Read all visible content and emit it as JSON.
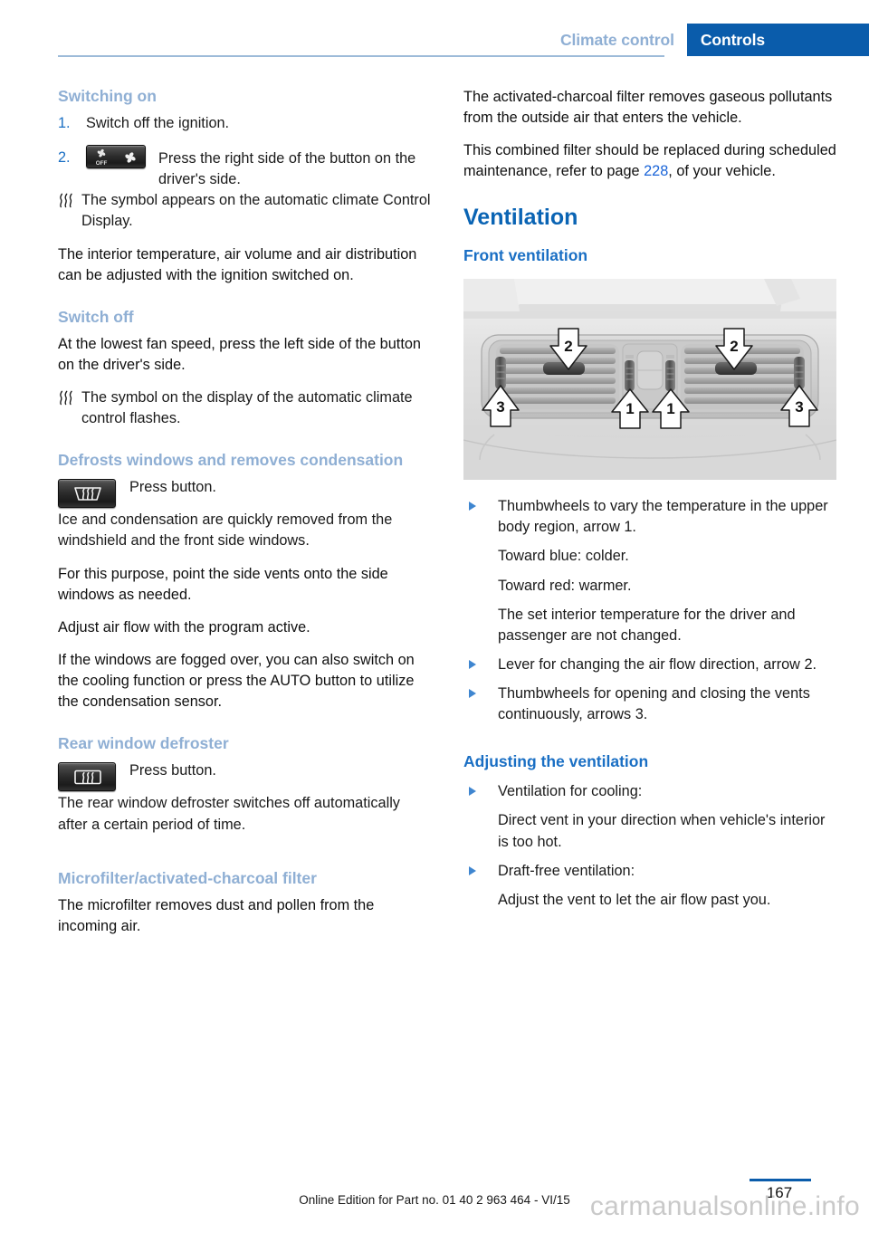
{
  "header": {
    "chapter": "Climate control",
    "section": "Controls"
  },
  "left_column": {
    "switching_on": {
      "heading": "Switching on",
      "step1_num": "1.",
      "step1_text": "Switch off the ignition.",
      "step2_num": "2.",
      "step2_icon_off_label": "OFF",
      "step2_text": "Press the right side of the button on the driver's side.",
      "note": "The symbol appears on the automatic climate Control Display.",
      "para": "The interior temperature, air volume and air distribution can be adjusted with the ignition switched on."
    },
    "switch_off": {
      "heading": "Switch off",
      "para": "At the lowest fan speed, press the left side of the button on the driver's side.",
      "note": "The symbol on the display of the automatic climate control flashes."
    },
    "defrost": {
      "heading": "Defrosts windows and removes condensation",
      "press_button": "Press button.",
      "para1": "Ice and condensation are quickly removed from the windshield and the front side windows.",
      "para2": "For this purpose, point the side vents onto the side windows as needed.",
      "para3": "Adjust air flow with the program active.",
      "para4": "If the windows are fogged over, you can also switch on the cooling function or press the AUTO button to utilize the condensation sensor."
    },
    "rear_defroster": {
      "heading": "Rear window defroster",
      "press_button": "Press button.",
      "para": "The rear window defroster switches off automatically after a certain period of time."
    },
    "microfilter": {
      "heading": "Microfilter/activated-charcoal filter",
      "para": "The microfilter removes dust and pollen from the incoming air."
    }
  },
  "right_column": {
    "charcoal_para": "The activated-charcoal filter removes gaseous pollutants from the outside air that enters the vehicle.",
    "combined_para_before": "This combined filter should be replaced during scheduled maintenance, refer to page ",
    "combined_para_xref": "228",
    "combined_para_after": ", of your vehicle.",
    "ventilation_title": "Ventilation",
    "front_ventilation_title": "Front ventilation",
    "figure": {
      "name": "front-vent-illustration",
      "callouts": [
        "2",
        "2",
        "3",
        "3",
        "1",
        "1"
      ]
    },
    "bullets": [
      {
        "text": "Thumbwheels to vary the temperature in the upper body region, arrow 1.",
        "subs": [
          "Toward blue: colder.",
          "Toward red: warmer.",
          "The set interior temperature for the driver and passenger are not changed."
        ]
      },
      {
        "text": "Lever for changing the air flow direction, arrow 2.",
        "subs": []
      },
      {
        "text": "Thumbwheels for opening and closing the vents continuously, arrows 3.",
        "subs": []
      }
    ],
    "adjusting_title": "Adjusting the ventilation",
    "adjusting_bullets": [
      {
        "text": "Ventilation for cooling:",
        "subs": [
          "Direct vent in your direction when vehicle's interior is too hot."
        ]
      },
      {
        "text": "Draft-free ventilation:",
        "subs": [
          "Adjust the vent to let the air flow past you."
        ]
      }
    ]
  },
  "footer": {
    "edition_note": "Online Edition for Part no. 01 40 2 963 464 - VI/15",
    "page_number": "167",
    "watermark": "carmanualsonline.info"
  },
  "colors": {
    "header_blue": "#0a5cab",
    "heading_light_blue": "#8fafd4",
    "heading_blue": "#0a64b4",
    "xref_blue": "#1a64d8",
    "bullet_blue": "#3f86d0"
  }
}
